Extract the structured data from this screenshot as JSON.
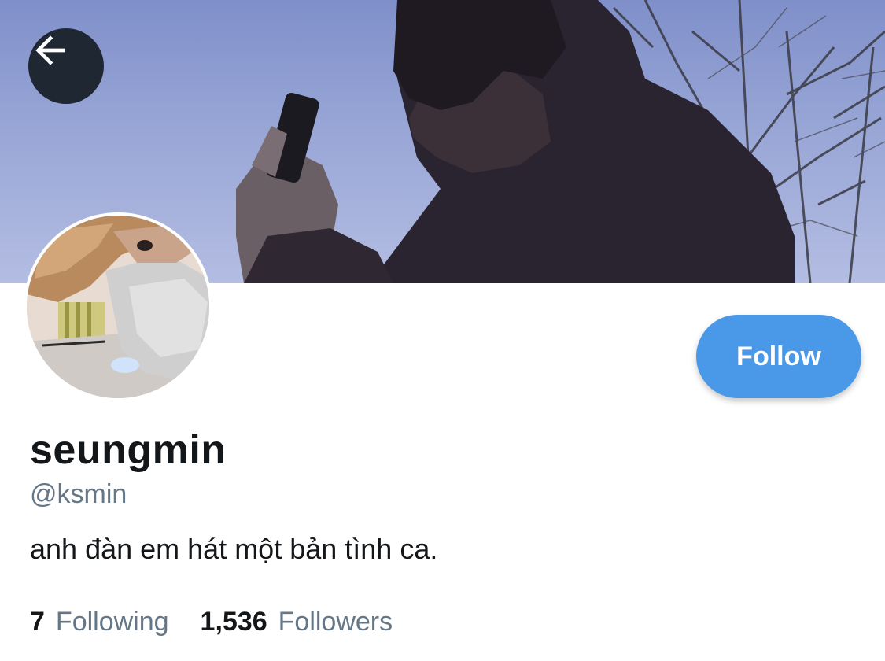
{
  "header": {
    "back_icon": "arrow-left-icon",
    "banner_image": "profile-header-photo"
  },
  "profile": {
    "display_name": "seungmin",
    "handle": "@ksmin",
    "bio": "anh đàn em hát một bản tình ca.",
    "avatar_image": "profile-avatar-photo"
  },
  "actions": {
    "follow_label": "Follow"
  },
  "stats": {
    "following_count": "7",
    "following_label": "Following",
    "followers_count": "1,536",
    "followers_label": "Followers"
  },
  "colors": {
    "accent": "#4a99e9",
    "text_primary": "#14171a",
    "text_secondary": "#657786",
    "back_button_bg": "#1f2733"
  }
}
